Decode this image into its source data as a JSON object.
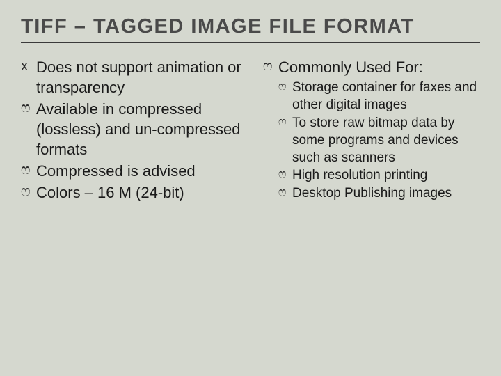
{
  "title": "TIFF – TAGGED IMAGE FILE FORMAT",
  "bullets": {
    "x": "x",
    "script": "ෆ"
  },
  "left": [
    {
      "b": "x",
      "t": "Does not support animation or transparency"
    },
    {
      "b": "script",
      "t": "Available in compressed (lossless) and un-compressed formats"
    },
    {
      "b": "script",
      "t": "Compressed is advised"
    },
    {
      "b": "script",
      "t": "Colors – 16 M  (24-bit)"
    }
  ],
  "right_head": {
    "b": "script",
    "t": "Commonly Used For:"
  },
  "right_sub": [
    {
      "b": "script",
      "t": "Storage container for faxes and other digital images"
    },
    {
      "b": "script",
      "t": "To store raw bitmap data by some programs and devices such as scanners"
    },
    {
      "b": "script",
      "t": "High resolution printing"
    },
    {
      "b": "script",
      "t": "Desktop Publishing images"
    }
  ]
}
